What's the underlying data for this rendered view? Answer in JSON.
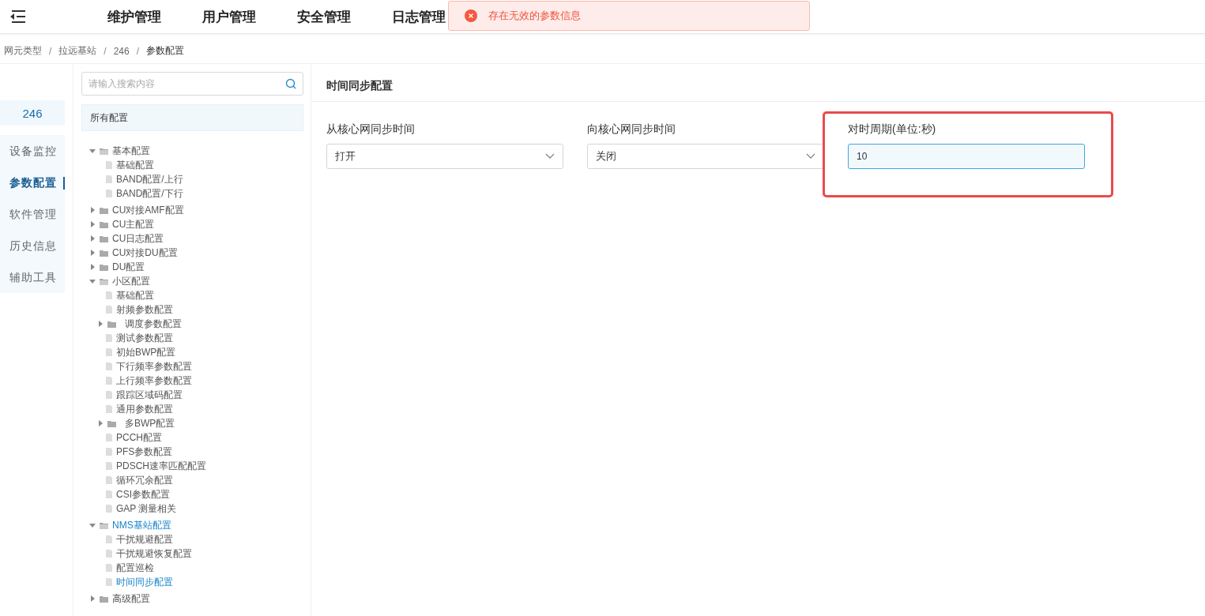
{
  "top_nav": {
    "menu_items": [
      {
        "label": "维护管理"
      },
      {
        "label": "用户管理"
      },
      {
        "label": "安全管理"
      },
      {
        "label": "日志管理"
      }
    ]
  },
  "alert": {
    "kind": "error",
    "message": "存在无效的参数信息"
  },
  "breadcrumb": [
    {
      "label": "网元类型",
      "separator": "/"
    },
    {
      "label": "拉远基站",
      "separator": "/"
    },
    {
      "label": "246",
      "separator": "/"
    },
    {
      "label": "参数配置"
    }
  ],
  "device_badge": "246",
  "side_menu": [
    {
      "label": "设备监控",
      "selected": false
    },
    {
      "label": "参数配置",
      "selected": true
    },
    {
      "label": "软件管理",
      "selected": false
    },
    {
      "label": "历史信息",
      "selected": false
    },
    {
      "label": "辅助工具",
      "selected": false
    }
  ],
  "search": {
    "placeholder": "请输入搜索内容"
  },
  "tree": {
    "root": "所有配置",
    "items": [
      {
        "label": "基本配置",
        "kind": "folder",
        "expanded": true,
        "selected": false,
        "children": [
          {
            "label": "基础配置",
            "kind": "file",
            "selected": false
          },
          {
            "label": "BAND配置/上行",
            "kind": "file",
            "selected": false
          },
          {
            "label": "BAND配置/下行",
            "kind": "file",
            "selected": false
          }
        ]
      },
      {
        "label": "CU对接AMF配置",
        "kind": "folder",
        "expanded": false,
        "selected": false
      },
      {
        "label": "CU主配置",
        "kind": "folder",
        "expanded": false,
        "selected": false
      },
      {
        "label": "CU日志配置",
        "kind": "folder",
        "expanded": false,
        "selected": false
      },
      {
        "label": "CU对接DU配置",
        "kind": "folder",
        "expanded": false,
        "selected": false
      },
      {
        "label": "DU配置",
        "kind": "folder",
        "expanded": false,
        "selected": false
      },
      {
        "label": "小区配置",
        "kind": "folder",
        "expanded": true,
        "selected": false,
        "children": [
          {
            "label": "基础配置",
            "kind": "file",
            "selected": false
          },
          {
            "label": "射频参数配置",
            "kind": "file",
            "selected": false
          },
          {
            "label": "调度参数配置",
            "kind": "folder",
            "expanded": false,
            "selected": false
          },
          {
            "label": "测试参数配置",
            "kind": "file",
            "selected": false
          },
          {
            "label": "初始BWP配置",
            "kind": "file",
            "selected": false
          },
          {
            "label": "下行频率参数配置",
            "kind": "file",
            "selected": false
          },
          {
            "label": "上行频率参数配置",
            "kind": "file",
            "selected": false
          },
          {
            "label": "跟踪区域码配置",
            "kind": "file",
            "selected": false
          },
          {
            "label": "通用参数配置",
            "kind": "file",
            "selected": false
          },
          {
            "label": "多BWP配置",
            "kind": "folder",
            "expanded": false,
            "selected": false
          },
          {
            "label": "PCCH配置",
            "kind": "file",
            "selected": false
          },
          {
            "label": "PFS参数配置",
            "kind": "file",
            "selected": false
          },
          {
            "label": "PDSCH速率匹配配置",
            "kind": "file",
            "selected": false
          },
          {
            "label": "循环冗余配置",
            "kind": "file",
            "selected": false
          },
          {
            "label": "CSI参数配置",
            "kind": "file",
            "selected": false
          },
          {
            "label": "GAP 测量相关",
            "kind": "file",
            "selected": false
          }
        ]
      },
      {
        "label": "NMS基站配置",
        "kind": "folder",
        "expanded": true,
        "selected": false,
        "children": [
          {
            "label": "干扰规避配置",
            "kind": "file",
            "selected": false
          },
          {
            "label": "干扰规避恢复配置",
            "kind": "file",
            "selected": false
          },
          {
            "label": "配置巡检",
            "kind": "file",
            "selected": false
          },
          {
            "label": "时间同步配置",
            "kind": "file",
            "selected": true
          }
        ]
      },
      {
        "label": "高级配置",
        "kind": "folder",
        "expanded": false,
        "selected": false
      }
    ]
  },
  "panel": {
    "title": "时间同步配置",
    "fields": [
      {
        "label": "从核心网同步时间",
        "kind": "select",
        "value": "打开",
        "highlighted": false
      },
      {
        "label": "向核心网同步时间",
        "kind": "select",
        "value": "关闭",
        "highlighted": false
      },
      {
        "label": "对时周期(单位:秒)",
        "kind": "input",
        "value": "10",
        "highlighted": true
      }
    ]
  }
}
